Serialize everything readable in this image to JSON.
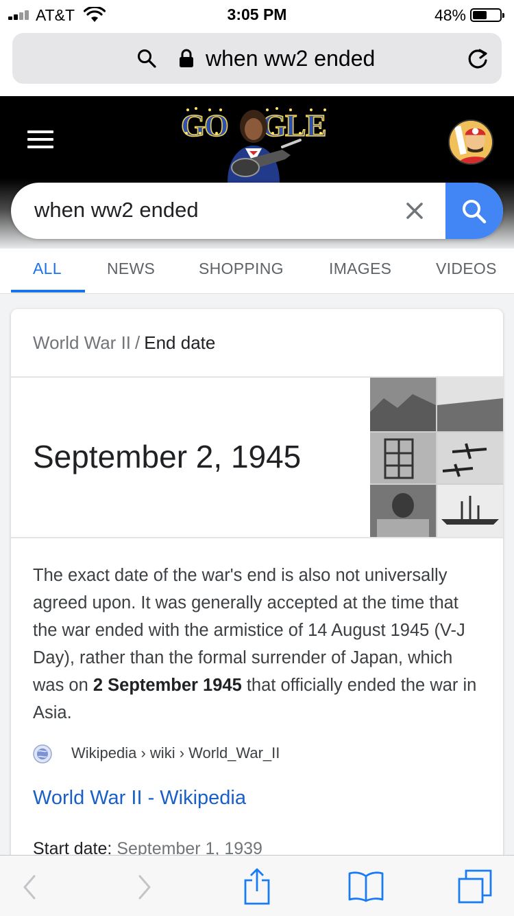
{
  "status": {
    "carrier": "AT&T",
    "time": "3:05 PM",
    "battery_pct": "48%",
    "battery_level": 0.48
  },
  "browser": {
    "url_text": "when ww2 ended"
  },
  "search": {
    "query": "when ww2 ended"
  },
  "tabs": [
    {
      "label": "ALL",
      "active": true
    },
    {
      "label": "NEWS"
    },
    {
      "label": "SHOPPING"
    },
    {
      "label": "IMAGES"
    },
    {
      "label": "VIDEOS"
    }
  ],
  "card": {
    "breadcrumb_parent": "World War II",
    "breadcrumb_sep": "/",
    "breadcrumb_current": "End date",
    "answer": "September 2, 1945",
    "desc_part1": "The exact date of the war's end is also not universally agreed upon. It was generally accepted at the time that the war ended with the armistice of 14 August 1945 (V-J Day), rather than the formal surrender of Japan, which was on ",
    "desc_bold": "2 September 1945",
    "desc_part2": " that officially ended the war in Asia.",
    "source_path": "Wikipedia › wiki › World_War_II",
    "link_title": "World War II - Wikipedia",
    "start_label": "Start date:",
    "start_value": "September 1, 1939"
  },
  "colors": {
    "accent": "#1a73e8",
    "search_button": "#4285f4",
    "header_bg": "#000000"
  },
  "icons": [
    "signal-icon",
    "wifi-icon",
    "battery-icon",
    "search-icon",
    "lock-icon",
    "reload-icon",
    "menu-icon",
    "clear-icon",
    "globe-icon",
    "back-icon",
    "forward-icon",
    "share-icon",
    "bookmarks-icon",
    "tabs-icon"
  ]
}
